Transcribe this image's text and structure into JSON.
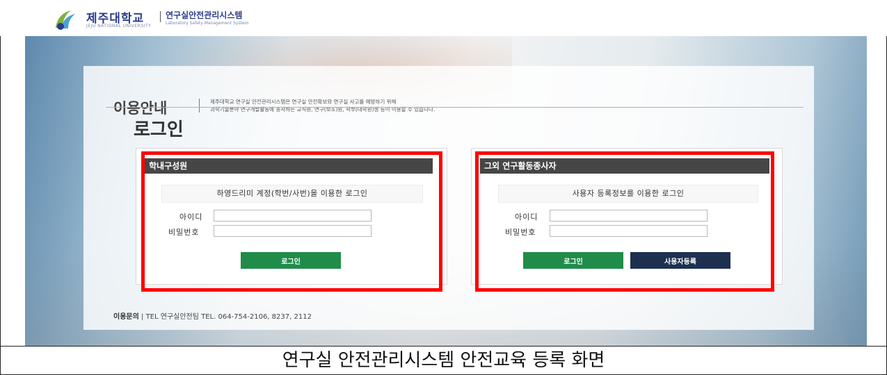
{
  "header": {
    "university_name": "제주대학교",
    "university_en": "JEJU NATIONAL UNIVERSITY",
    "system_name": "연구실안전관리시스템",
    "system_en": "Laboratory Safety Management System"
  },
  "info": {
    "title": "이용안내",
    "line1": "제주대학교 연구실 안전관리시스템은 연구실 안전확보와 연구실 사고를 예방하기 위해",
    "line2": "과학기술분야 연구개발활동에 종사하는 교직원, 연구(보조)원, 학부(대학원)생 등이 이용할 수 있습니다."
  },
  "login": {
    "title": "로그인",
    "internal": {
      "header": "학내구성원",
      "subtitle": "하영드리미 계정(학번/사번)을 이용한 로그인",
      "id_label": "아이디",
      "pw_label": "비밀번호",
      "login_button": "로그인"
    },
    "external": {
      "header": "그외 연구활동종사자",
      "subtitle": "사용자 등록정보를 이용한 로그인",
      "id_label": "아이디",
      "pw_label": "비밀번호",
      "login_button": "로그인",
      "register_button": "사용자등록"
    }
  },
  "contact": {
    "label": "이용문의",
    "text": "TEL 연구실안전팀 TEL. 064-754-2106, 8237, 2112"
  },
  "caption": "연구실 안전관리시스템 안전교육 등록 화면",
  "colors": {
    "highlight": "#ff0000",
    "login_button": "#1f8c4a",
    "register_button": "#1d3050",
    "box_header": "#464646",
    "brand": "#2a3c8c"
  }
}
